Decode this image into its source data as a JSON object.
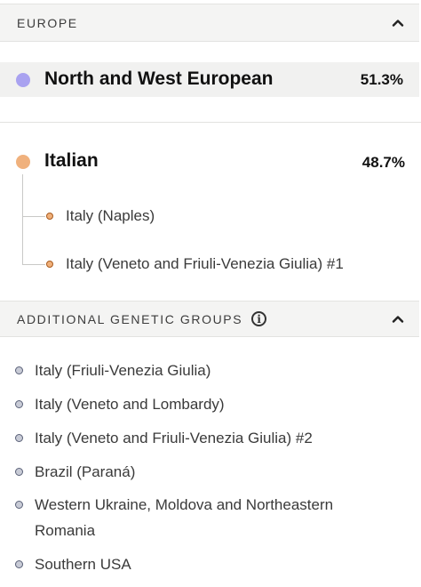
{
  "europe_section": {
    "title": "EUROPE",
    "chevron_icon": "chevron-up-icon"
  },
  "populations": [
    {
      "name": "North and West European",
      "percent": "51.3%",
      "color": "#a9a2f0"
    },
    {
      "name": "Italian",
      "percent": "48.7%",
      "color": "#f0b17d",
      "subregions": [
        "Italy (Naples)",
        "Italy (Veneto and Friuli-Venezia Giulia) #1"
      ]
    }
  ],
  "additional_section": {
    "title": "ADDITIONAL GENETIC GROUPS",
    "info_icon": "info-icon",
    "chevron_icon": "chevron-up-icon",
    "items": [
      "Italy (Friuli-Venezia Giulia)",
      "Italy (Veneto and Lombardy)",
      "Italy (Veneto and Friuli-Venezia Giulia) #2",
      "Brazil (Paraná)",
      "Western Ukraine, Moldova and Northeastern Romania",
      "Southern USA"
    ]
  }
}
